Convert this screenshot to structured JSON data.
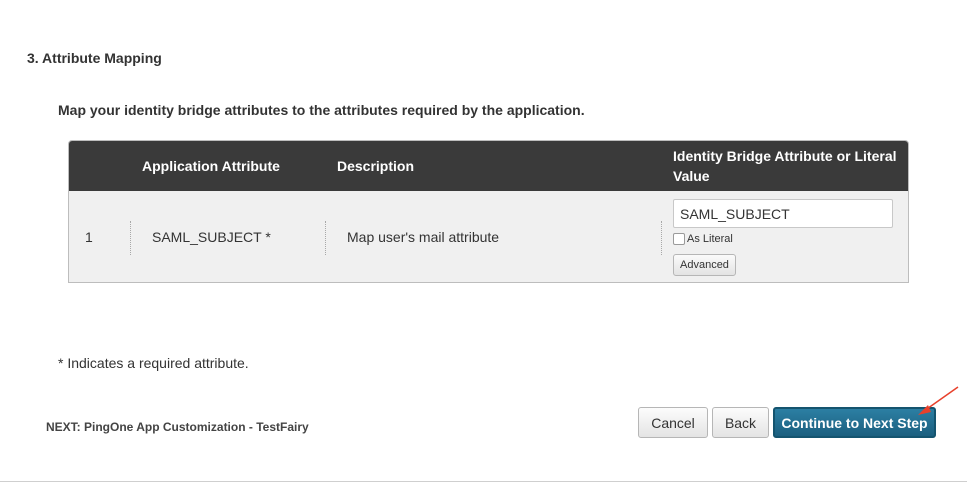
{
  "section": {
    "title": "3. Attribute Mapping"
  },
  "intro": "Map your identity bridge attributes to the attributes required by the application.",
  "table": {
    "headers": {
      "number": "",
      "application_attribute": "Application Attribute",
      "description": "Description",
      "identity_bridge": "Identity Bridge Attribute or Literal Value"
    },
    "rows": [
      {
        "number": "1",
        "application_attribute": "SAML_SUBJECT *",
        "description": "Map user's mail attribute",
        "identity_bridge_value": "SAML_SUBJECT",
        "as_literal_label": "As Literal",
        "as_literal_checked": false,
        "advanced_label": "Advanced"
      }
    ]
  },
  "required_note": "* Indicates a required attribute.",
  "footer": {
    "next_label": "NEXT: PingOne App Customization - TestFairy",
    "cancel_label": "Cancel",
    "back_label": "Back",
    "continue_label": "Continue to Next Step"
  },
  "colors": {
    "header_bg": "#3a3a3a",
    "row_bg": "#f0f0f0",
    "primary_button": "#1f6585",
    "annotation_arrow": "#e8412c"
  },
  "icons": {
    "annotation": "red-arrow-icon"
  }
}
